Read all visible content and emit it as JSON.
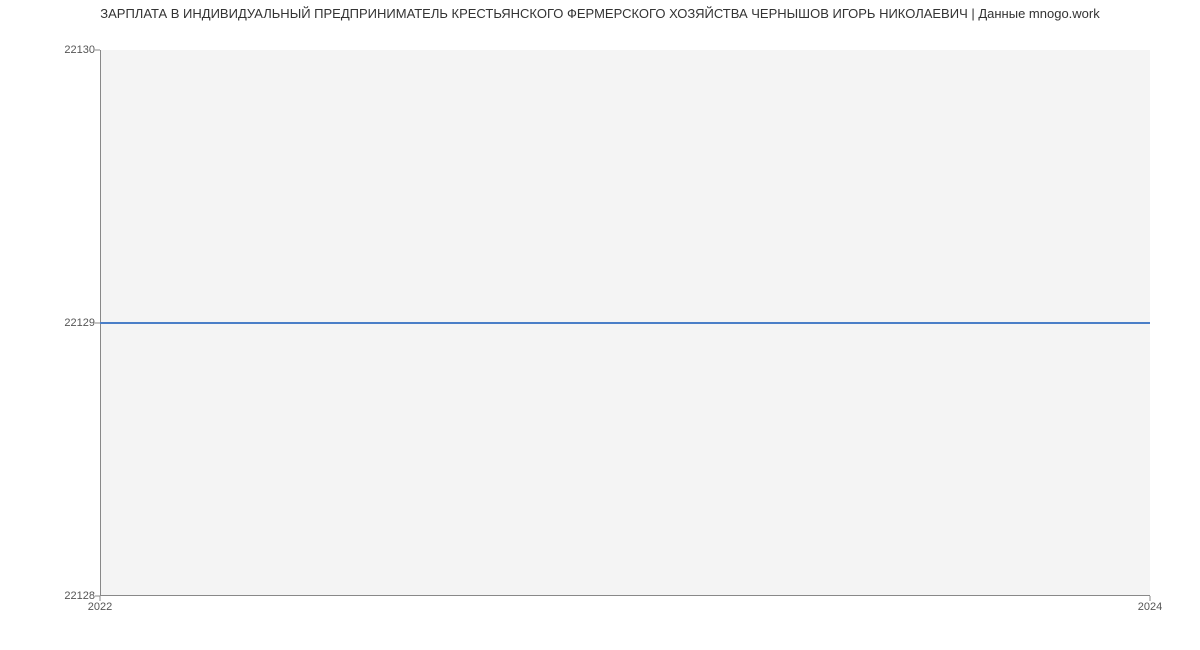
{
  "chart_data": {
    "type": "line",
    "title": "ЗАРПЛАТА В ИНДИВИДУАЛЬНЫЙ ПРЕДПРИНИМАТЕЛЬ КРЕСТЬЯНСКОГО ФЕРМЕРСКОГО ХОЗЯЙСТВА ЧЕРНЫШОВ ИГОРЬ НИКОЛАЕВИЧ | Данные mnogo.work",
    "xlabel": "",
    "ylabel": "",
    "x": [
      2022,
      2024
    ],
    "values": [
      22129,
      22129
    ],
    "xlim": [
      2022,
      2024
    ],
    "ylim": [
      22128,
      22130
    ],
    "y_ticks": [
      22128,
      22129,
      22130
    ],
    "x_ticks": [
      2022,
      2024
    ]
  }
}
